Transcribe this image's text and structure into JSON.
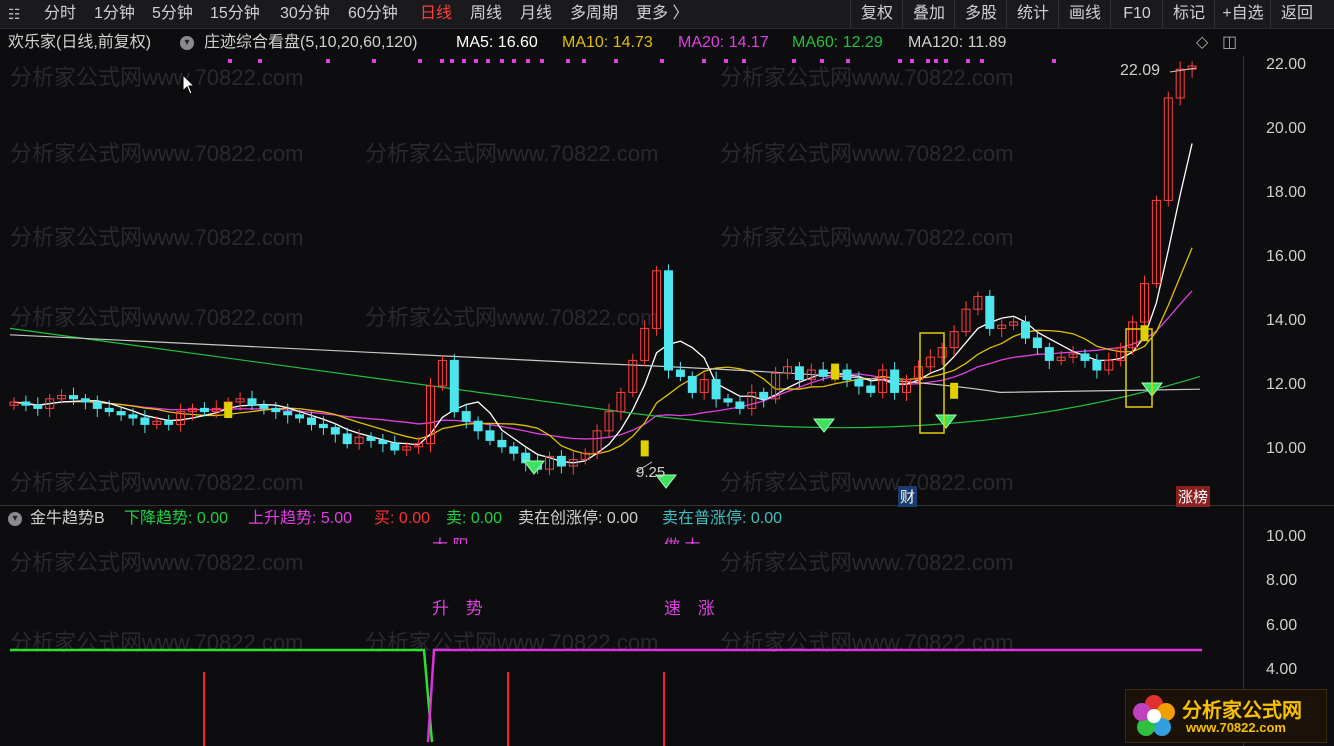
{
  "toolbar": {
    "periods": [
      "分时",
      "1分钟",
      "5分钟",
      "15分钟",
      "30分钟",
      "60分钟",
      "日线",
      "周线",
      "月线",
      "多周期",
      "更多 〉"
    ],
    "active_period": "日线",
    "right_buttons": [
      "复权",
      "叠加",
      "多股",
      "统计",
      "画线",
      "F10",
      "标记",
      "+自选",
      "返回"
    ]
  },
  "header": {
    "stock_name": "欢乐家(日线,前复权)",
    "indicator_name": "庄迹综合看盘(5,10,20,60,120)",
    "ma5_label": "MA5: 16.60",
    "ma10_label": "MA10: 14.73",
    "ma20_label": "MA20: 14.17",
    "ma60_label": "MA60: 12.29",
    "ma120_label": "MA120: 11.89"
  },
  "colors": {
    "up": "#ff4040",
    "down": "#4ee6ee",
    "ma5": "#ffffff",
    "ma10": "#e0c000",
    "ma20": "#e040e0",
    "ma60": "#20c040",
    "ma120": "#c8c8c8",
    "highlight": "#e0d000"
  },
  "main_axis": {
    "labels": [
      "22.00",
      "20.00",
      "18.00",
      "16.00",
      "14.00",
      "12.00",
      "10.00"
    ],
    "max_label": "22.09",
    "min_label": "9.25",
    "badge_cai": "财",
    "badge_zhangbang": "涨榜"
  },
  "sub": {
    "indicator_name": "金牛趋势B",
    "down_trend": "下降趋势: 0.00",
    "up_trend": "上升趋势: 5.00",
    "buy": "买: 0.00",
    "sell": "卖: 0.00",
    "sell_limit": "卖在创涨停: 0.00",
    "sell_normal": "卖在普涨停: 0.00",
    "axis_labels": [
      "10.00",
      "8.00",
      "6.00",
      "4.00"
    ],
    "text_shengshi": "升 势",
    "text_suzhang": "速 涨",
    "text_top_left": "大 阳",
    "text_top_right": "做 大"
  },
  "logo": {
    "title": "分析家公式网",
    "url": "www.70822.com"
  },
  "watermark_text": "分析家公式网www.70822.com"
}
